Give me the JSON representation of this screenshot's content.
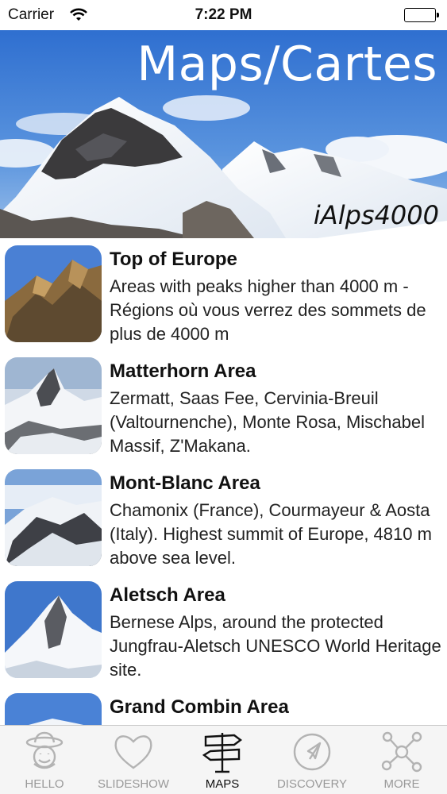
{
  "status_bar": {
    "carrier": "Carrier",
    "time": "7:22 PM"
  },
  "hero": {
    "title": "Maps/Cartes",
    "subtitle": "iAlps4000"
  },
  "items": [
    {
      "title": "Top of Europe",
      "desc": "Areas with peaks higher than 4000 m - Régions où vous verrez des sommets de plus de 4000 m"
    },
    {
      "title": "Matterhorn Area",
      "desc": "Zermatt, Saas Fee, Cervinia-Breuil (Valtournenche), Monte Rosa, Mischabel Massif, Z'Makana."
    },
    {
      "title": "Mont-Blanc Area",
      "desc": "Chamonix (France), Courmayeur & Aosta (Italy). Highest summit of Europe, 4810 m above sea level."
    },
    {
      "title": "Aletsch Area",
      "desc": "Bernese Alps, around the protected Jungfrau-Aletsch UNESCO World Heritage site."
    },
    {
      "title": "Grand Combin Area",
      "desc": ""
    }
  ],
  "tabs": [
    {
      "label": "HELLO",
      "icon": "smiley-hat-icon"
    },
    {
      "label": "SLIDESHOW",
      "icon": "heart-icon"
    },
    {
      "label": "MAPS",
      "icon": "signpost-icon",
      "active": true
    },
    {
      "label": "DISCOVERY",
      "icon": "compass-icon"
    },
    {
      "label": "MORE",
      "icon": "network-icon"
    }
  ]
}
